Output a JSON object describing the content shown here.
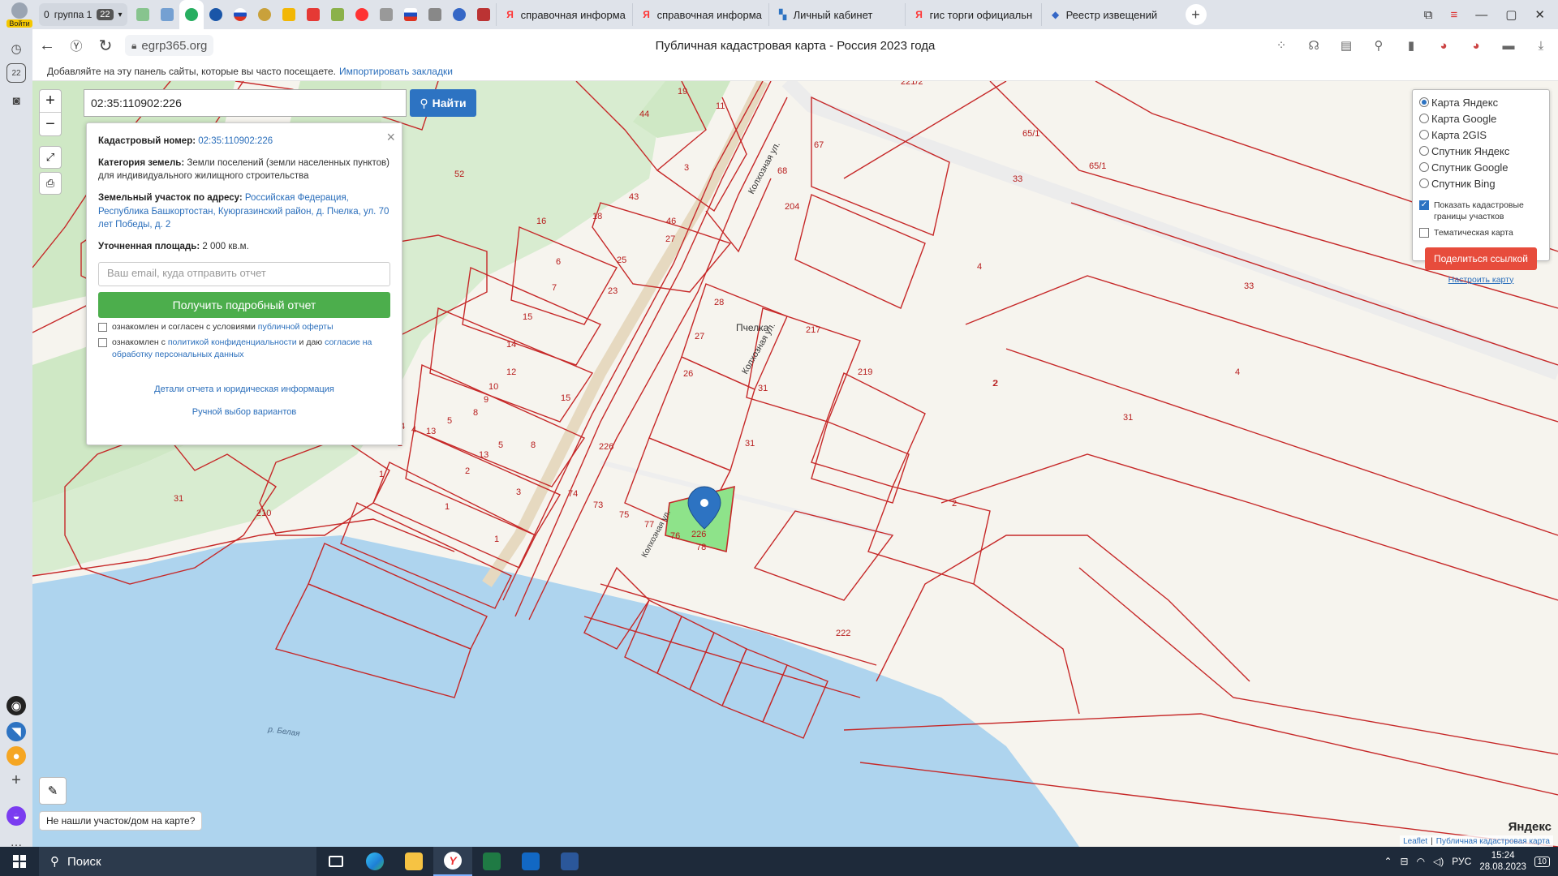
{
  "browser": {
    "login_label": "Войти",
    "tab_group": {
      "label": "группа 1",
      "count_a": "0",
      "count_b": "22"
    },
    "tabs": [
      {
        "label": "справочная информа",
        "icon": "yandex-icon"
      },
      {
        "label": "справочная информа",
        "icon": "yandex-icon"
      },
      {
        "label": "Личный кабинет",
        "icon": "cabinet-icon"
      },
      {
        "label": "гис торги официальн",
        "icon": "yandex-icon"
      },
      {
        "label": "Реестр извещений",
        "icon": "registry-icon"
      }
    ],
    "url": "egrp365.org",
    "page_title": "Публичная кадастровая карта - Россия 2023 года",
    "bookmarks_text": "Добавляйте на эту панель сайты, которые вы часто посещаете.",
    "bookmarks_link": "Импортировать закладки",
    "sidebar_badge": "22"
  },
  "map": {
    "search_value": "02:35:110902:226",
    "search_button": "Найти",
    "popup": {
      "cadnum_label": "Кадастровый номер:",
      "cadnum_value": "02:35:110902:226",
      "category_label": "Категория земель:",
      "category_value": "Земли поселений (земли населенных пунктов)",
      "use_value": "для индивидуального жилищного строительства",
      "address_label": "Земельный участок по адресу:",
      "address_value": "Российская Федерация, Республика Башкортостан, Куюргазинский район, д. Пчелка, ул. 70 лет Победы, д. 2",
      "area_label": "Уточненная площадь:",
      "area_value": "2 000 кв.м.",
      "email_placeholder": "Ваш email, куда отправить отчет",
      "report_button": "Получить подробный отчет",
      "agree1_text": "ознакомлен и согласен с условиями",
      "agree1_link": "публичной оферты",
      "agree2_text": "ознакомлен с",
      "agree2_link": "политикой конфиденциальности",
      "agree2_text2": "и даю",
      "agree2_link2": "согласие на обработку персональных данных",
      "details_link": "Детали отчета и юридическая информация",
      "manual_link": "Ручной выбор вариантов"
    },
    "layers": {
      "options": [
        {
          "label": "Карта Яндекс",
          "selected": true
        },
        {
          "label": "Карта Google",
          "selected": false
        },
        {
          "label": "Карта 2GIS",
          "selected": false
        },
        {
          "label": "Спутник Яндекс",
          "selected": false
        },
        {
          "label": "Спутник Google",
          "selected": false
        },
        {
          "label": "Спутник Bing",
          "selected": false
        }
      ],
      "show_borders": "Показать кадастровые границы участков",
      "show_borders_checked": true,
      "thematic": "Тематическая карта",
      "thematic_checked": false,
      "share_button": "Поделиться ссылкой",
      "configure_link": "Настроить карту"
    },
    "labels": {
      "village": "Пчелка",
      "street1": "Колхозная ул.",
      "street2": "Колхозная ул.",
      "street3": "Колхозная ул.",
      "river": "р. Белая",
      "selected_parcel": "226"
    },
    "parcel_numbers": [
      "19",
      "44",
      "11",
      "221/2",
      "65/1",
      "65/1",
      "33",
      "3",
      "67",
      "68",
      "52",
      "43",
      "204",
      "18",
      "16",
      "46",
      "27",
      "52",
      "4",
      "6",
      "25",
      "7",
      "23",
      "15",
      "28",
      "217",
      "33",
      "27",
      "14",
      "4",
      "12",
      "10",
      "26",
      "219",
      "31",
      "9",
      "15",
      "4",
      "8",
      "5",
      "4",
      "13",
      "31",
      "226",
      "2",
      "2",
      "31",
      "2",
      "13",
      "5",
      "8",
      "2",
      "1",
      "3",
      "74",
      "73",
      "75",
      "77",
      "76",
      "78",
      "1",
      "44",
      "31",
      "210",
      "1",
      "2",
      "2",
      "222"
    ],
    "not_found": "Не нашли участок/дом на карте?",
    "attribution_leaflet": "Leaflet",
    "attribution_pkk": "Публичная кадастровая карта",
    "yandex_mark": "Яндекс"
  },
  "taskbar": {
    "search_label": "Поиск",
    "lang": "РУС",
    "time": "15:24",
    "date": "28.08.2023",
    "notifications": "10"
  }
}
